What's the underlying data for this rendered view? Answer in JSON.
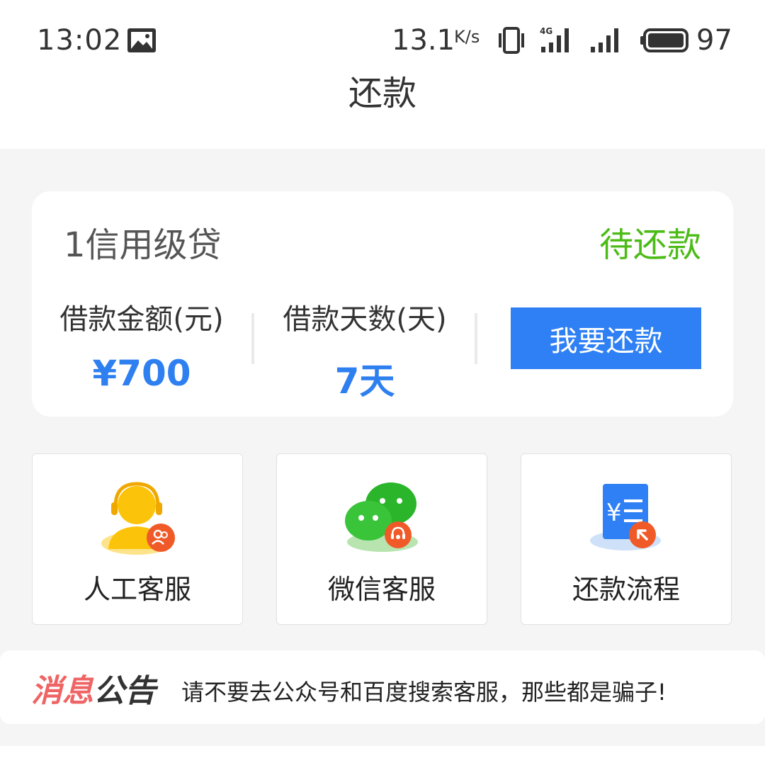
{
  "status_bar": {
    "time": "13:02",
    "speed": "13.1",
    "speed_unit": "K/s",
    "battery": "97"
  },
  "header": {
    "title": "还款"
  },
  "loan_card": {
    "name": "1信用级贷",
    "status": "待还款",
    "amount_label": "借款金额(元)",
    "amount_value": "¥700",
    "days_label": "借款天数(天)",
    "days_value": "7天",
    "repay_button": "我要还款"
  },
  "services": [
    {
      "label": "人工客服",
      "icon": "customer-service-icon"
    },
    {
      "label": "微信客服",
      "icon": "wechat-service-icon"
    },
    {
      "label": "还款流程",
      "icon": "repayment-process-icon"
    }
  ],
  "notice": {
    "logo_part1": "消息",
    "logo_part2": "公告",
    "text": "请不要去公众号和百度搜索客服，那些都是骗子!"
  },
  "colors": {
    "accent_blue": "#2f80f4",
    "status_green": "#4cbb17",
    "notice_red": "#ef6464"
  }
}
